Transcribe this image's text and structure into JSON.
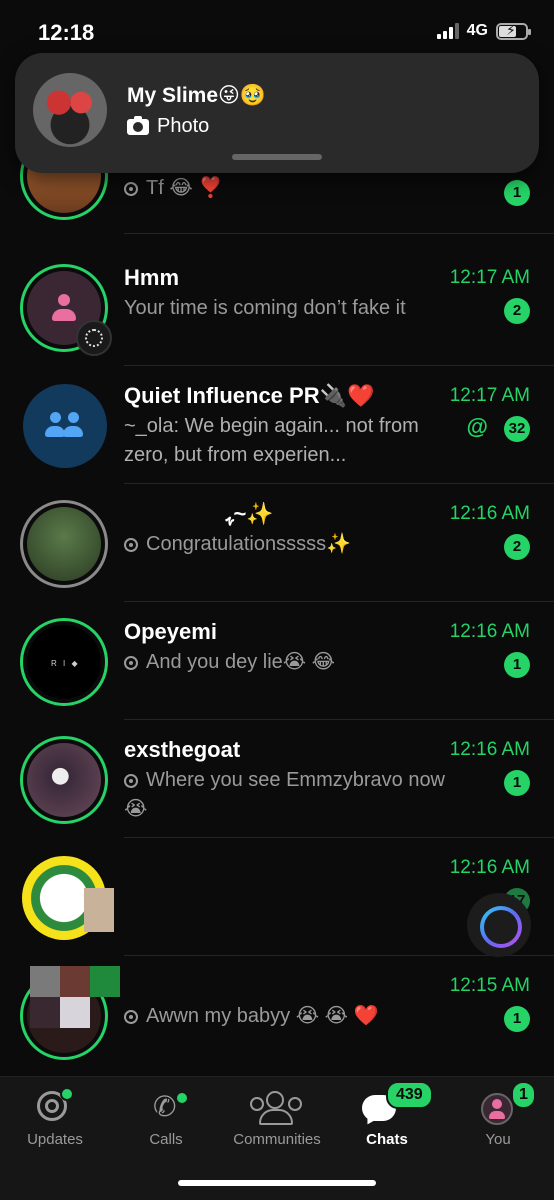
{
  "status_bar": {
    "time": "12:18",
    "network": "4G",
    "battery_level": "14"
  },
  "notification": {
    "title": "My Slime😜🥹",
    "subtitle": "Photo",
    "icon": "camera-icon"
  },
  "chats": [
    {
      "name": "",
      "preview": "Tf 😂 ❣️",
      "time": "",
      "unread": "1",
      "status_icon": true,
      "ring": "green"
    },
    {
      "name": "Hmm",
      "preview": "Your time is coming don’t fake it",
      "time": "12:17 AM",
      "unread": "2",
      "status_icon": false,
      "ring": "green"
    },
    {
      "name": "Quiet Influence PR🔌❤️",
      "preview": "~_ola: We begin again... not from zero, but from experien...",
      "time": "12:17 AM",
      "unread": "32",
      "mention": "@",
      "status_icon": false,
      "ring": "none"
    },
    {
      "name": "ﮩ~✨",
      "preview": "Congratulationsssss✨",
      "time": "12:16 AM",
      "unread": "2",
      "status_icon": true,
      "ring": "gray"
    },
    {
      "name": "Opeyemi",
      "preview": "And you dey lie😭 😂",
      "time": "12:16 AM",
      "unread": "1",
      "status_icon": true,
      "ring": "green"
    },
    {
      "name": "exsthegoat",
      "preview": "Where you see Emmzybravo now😭",
      "time": "12:16 AM",
      "unread": "1",
      "status_icon": true,
      "ring": "green"
    },
    {
      "name": "",
      "preview": "",
      "time": "12:16 AM",
      "unread": "17",
      "status_icon": false,
      "ring": "none"
    },
    {
      "name": "",
      "preview": "Awwn my babyy 😭 😭 ❤️",
      "time": "12:15 AM",
      "unread": "1",
      "status_icon": true,
      "ring": "green"
    }
  ],
  "tabs": [
    {
      "label": "Updates",
      "icon": "updates-icon"
    },
    {
      "label": "Calls",
      "icon": "phone-icon"
    },
    {
      "label": "Communities",
      "icon": "communities-icon"
    },
    {
      "label": "Chats",
      "icon": "chats-icon",
      "badge": "439",
      "active": true
    },
    {
      "label": "You",
      "icon": "profile-icon",
      "badge": "1"
    }
  ],
  "colors": {
    "accent": "#25d366",
    "background": "#0b0b0b",
    "tabbar": "#161616"
  }
}
